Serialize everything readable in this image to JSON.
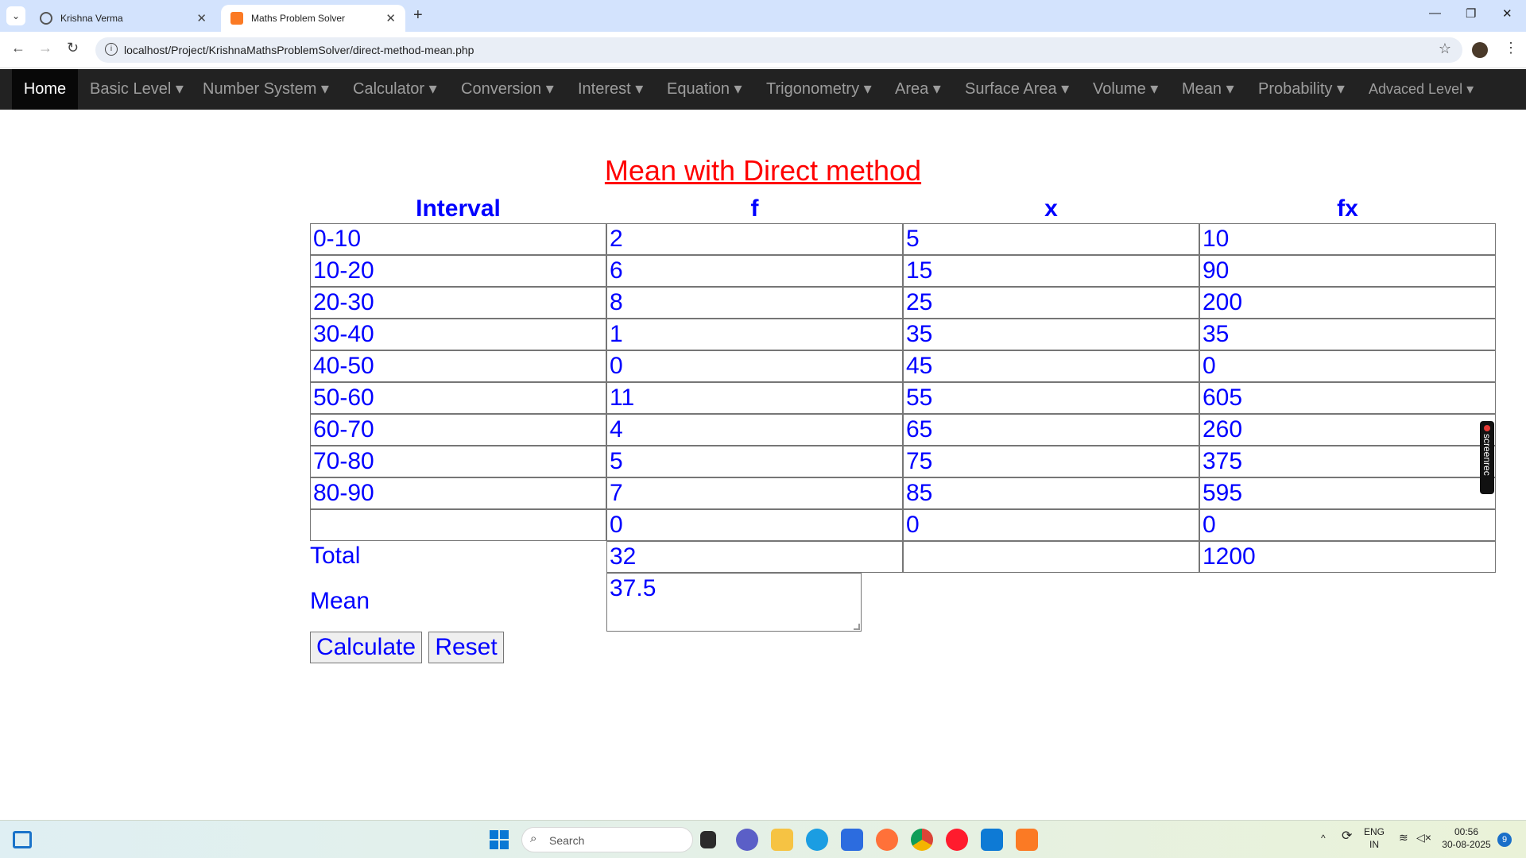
{
  "browser": {
    "tabs": [
      {
        "label": "Krishna Verma",
        "close": "✕"
      },
      {
        "label": "Maths Problem Solver",
        "close": "✕"
      }
    ],
    "new_tab": "+",
    "url": "localhost/Project/KrishnaMathsProblemSolver/direct-method-mean.php",
    "window_controls": {
      "minimize": "—",
      "restore": "❐",
      "close": "✕"
    }
  },
  "nav": {
    "items": [
      "Home",
      "Basic Level ▾",
      "Number System ▾",
      "Calculator ▾",
      "Conversion ▾",
      "Interest ▾",
      "Equation ▾",
      "Trigonometry ▾",
      "Area ▾",
      "Surface Area ▾",
      "Volume ▾",
      "Mean ▾",
      "Probability ▾",
      "Advaced Level ▾"
    ]
  },
  "page": {
    "title": "Mean with Direct method",
    "headers": [
      "Interval",
      "f",
      "x",
      "fx"
    ],
    "rows": [
      [
        "0-10",
        "2",
        "5",
        "10"
      ],
      [
        "10-20",
        "6",
        "15",
        "90"
      ],
      [
        "20-30",
        "8",
        "25",
        "200"
      ],
      [
        "30-40",
        "1",
        "35",
        "35"
      ],
      [
        "40-50",
        "0",
        "45",
        "0"
      ],
      [
        "50-60",
        "11",
        "55",
        "605"
      ],
      [
        "60-70",
        "4",
        "65",
        "260"
      ],
      [
        "70-80",
        "5",
        "75",
        "375"
      ],
      [
        "80-90",
        "7",
        "85",
        "595"
      ],
      [
        "",
        "0",
        "0",
        "0"
      ]
    ],
    "total_label": "Total",
    "total_f": "32",
    "total_x": "",
    "total_fx": "1200",
    "mean_label": "Mean",
    "mean_value": "37.5",
    "calculate_label": "Calculate",
    "reset_label": "Reset"
  },
  "overlay": {
    "screenrec_label": "screenrec"
  },
  "taskbar": {
    "search_placeholder": "Search",
    "lang_top": "ENG",
    "lang_bottom": "IN",
    "time": "00:56",
    "date": "30-08-2025",
    "notification_count": "9"
  },
  "colors": {
    "title": "#ff0000",
    "text": "#0000ff",
    "nav_bg": "#222222"
  }
}
